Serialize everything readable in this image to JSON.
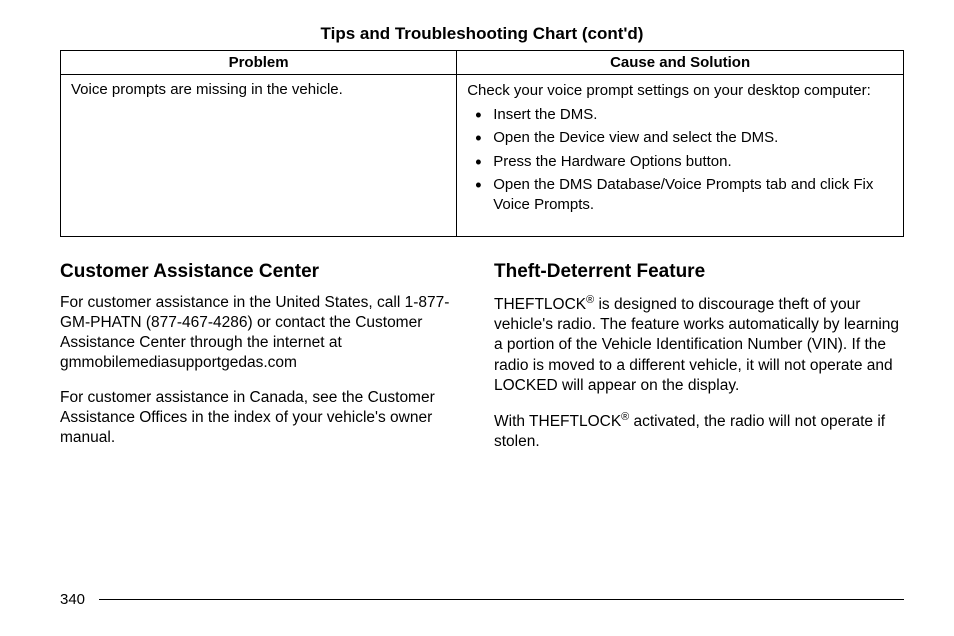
{
  "chart": {
    "title": "Tips and Troubleshooting Chart  (cont'd)",
    "headers": {
      "problem": "Problem",
      "solution": "Cause and Solution"
    },
    "row": {
      "problem": "Voice prompts are missing in the vehicle.",
      "solution_intro": "Check your voice prompt settings on your desktop computer:",
      "bullets": [
        "Insert the DMS.",
        "Open the Device view and select the DMS.",
        "Press the Hardware Options button.",
        "Open the DMS Database/Voice Prompts tab and click Fix Voice Prompts."
      ]
    }
  },
  "left": {
    "heading": "Customer Assistance Center",
    "p1": "For customer assistance in the United States, call 1-877-GM-PHATN (877-467-4286) or contact the Customer Assistance Center through the internet at gmmobilemediasupportgedas.com",
    "p2": "For customer assistance in Canada, see the Customer Assistance Offices in the index of your vehicle's owner manual."
  },
  "right": {
    "heading": "Theft-Deterrent Feature",
    "p1_a": "THEFTLOCK",
    "p1_b": " is designed to discourage theft of your vehicle's radio. The feature works automatically by learning a portion of the Vehicle Identification Number (VIN). If the radio is moved to a different vehicle, it will not operate and LOCKED will appear on the display.",
    "p2_a": "With THEFTLOCK",
    "p2_b": " activated, the radio will not operate if stolen.",
    "reg": "®"
  },
  "page_number": "340"
}
